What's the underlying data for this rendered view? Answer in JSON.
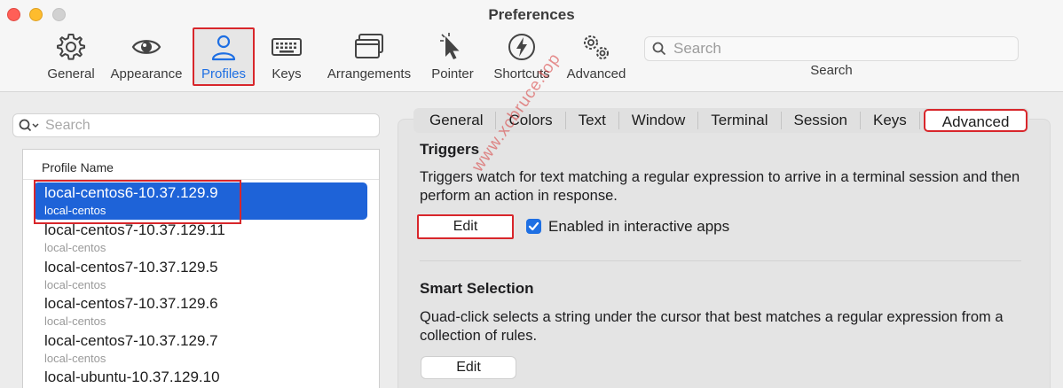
{
  "window": {
    "title": "Preferences"
  },
  "toolbar": {
    "items": [
      {
        "label": "General",
        "icon": "gear-icon"
      },
      {
        "label": "Appearance",
        "icon": "eye-icon"
      },
      {
        "label": "Profiles",
        "icon": "person-icon",
        "selected": true
      },
      {
        "label": "Keys",
        "icon": "keyboard-icon"
      },
      {
        "label": "Arrangements",
        "icon": "window-stack-icon"
      },
      {
        "label": "Pointer",
        "icon": "cursor-icon"
      },
      {
        "label": "Shortcuts",
        "icon": "bolt-icon"
      },
      {
        "label": "Advanced",
        "icon": "gears-icon"
      }
    ],
    "search": {
      "placeholder": "Search",
      "label": "Search"
    }
  },
  "profiles": {
    "search_placeholder": "Search",
    "column_header": "Profile Name",
    "rows": [
      {
        "name": "local-centos6-10.37.129.9",
        "tag": "local-centos",
        "selected": true
      },
      {
        "name": "local-centos7-10.37.129.11",
        "tag": "local-centos"
      },
      {
        "name": "local-centos7-10.37.129.5",
        "tag": "local-centos"
      },
      {
        "name": "local-centos7-10.37.129.6",
        "tag": "local-centos"
      },
      {
        "name": "local-centos7-10.37.129.7",
        "tag": "local-centos"
      },
      {
        "name": "local-ubuntu-10.37.129.10",
        "tag": ""
      }
    ]
  },
  "tabs": [
    {
      "label": "General"
    },
    {
      "label": "Colors"
    },
    {
      "label": "Text"
    },
    {
      "label": "Window"
    },
    {
      "label": "Terminal"
    },
    {
      "label": "Session"
    },
    {
      "label": "Keys"
    },
    {
      "label": "Advanced",
      "active": true
    }
  ],
  "triggers": {
    "title": "Triggers",
    "description": "Triggers watch for text matching a regular expression to arrive in a terminal session and then perform an action in response.",
    "edit_label": "Edit",
    "checkbox_label": "Enabled in interactive apps",
    "checkbox_checked": true
  },
  "smart_selection": {
    "title": "Smart Selection",
    "description": "Quad-click selects a string under the cursor that best matches a regular expression from a collection of rules.",
    "edit_label": "Edit"
  },
  "watermark": "www.xcbruce.top",
  "colors": {
    "accent": "#1e6fe3",
    "selection": "#1e63d8",
    "annotation": "#d8262b"
  }
}
